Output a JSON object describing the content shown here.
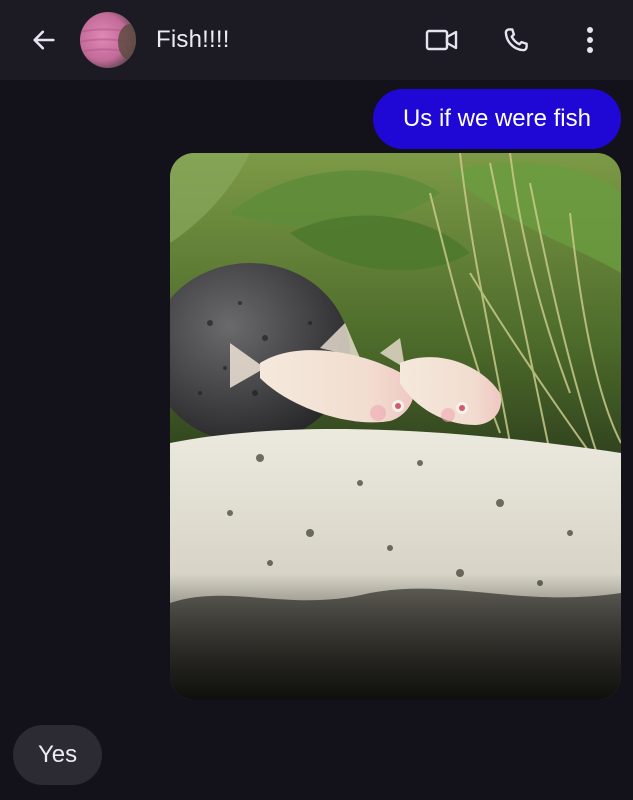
{
  "header": {
    "contact_name": "Fish!!!!",
    "icons": [
      "back-arrow-icon",
      "avatar",
      "video-call-icon",
      "phone-icon",
      "more-vert-icon"
    ]
  },
  "messages": [
    {
      "direction": "outgoing",
      "type": "text",
      "text": "Us if we were fish"
    },
    {
      "direction": "outgoing",
      "type": "image",
      "subject": "photo of two albino corydoras catfish on aquarium sand"
    },
    {
      "direction": "incoming",
      "type": "text",
      "text": "Yes"
    }
  ],
  "colors": {
    "background": "#13121b",
    "header": "#1c1b23",
    "outgoing_bubble": "#1f08d6",
    "incoming_bubble": "#2c2b33",
    "text": "#e8e6ef"
  }
}
